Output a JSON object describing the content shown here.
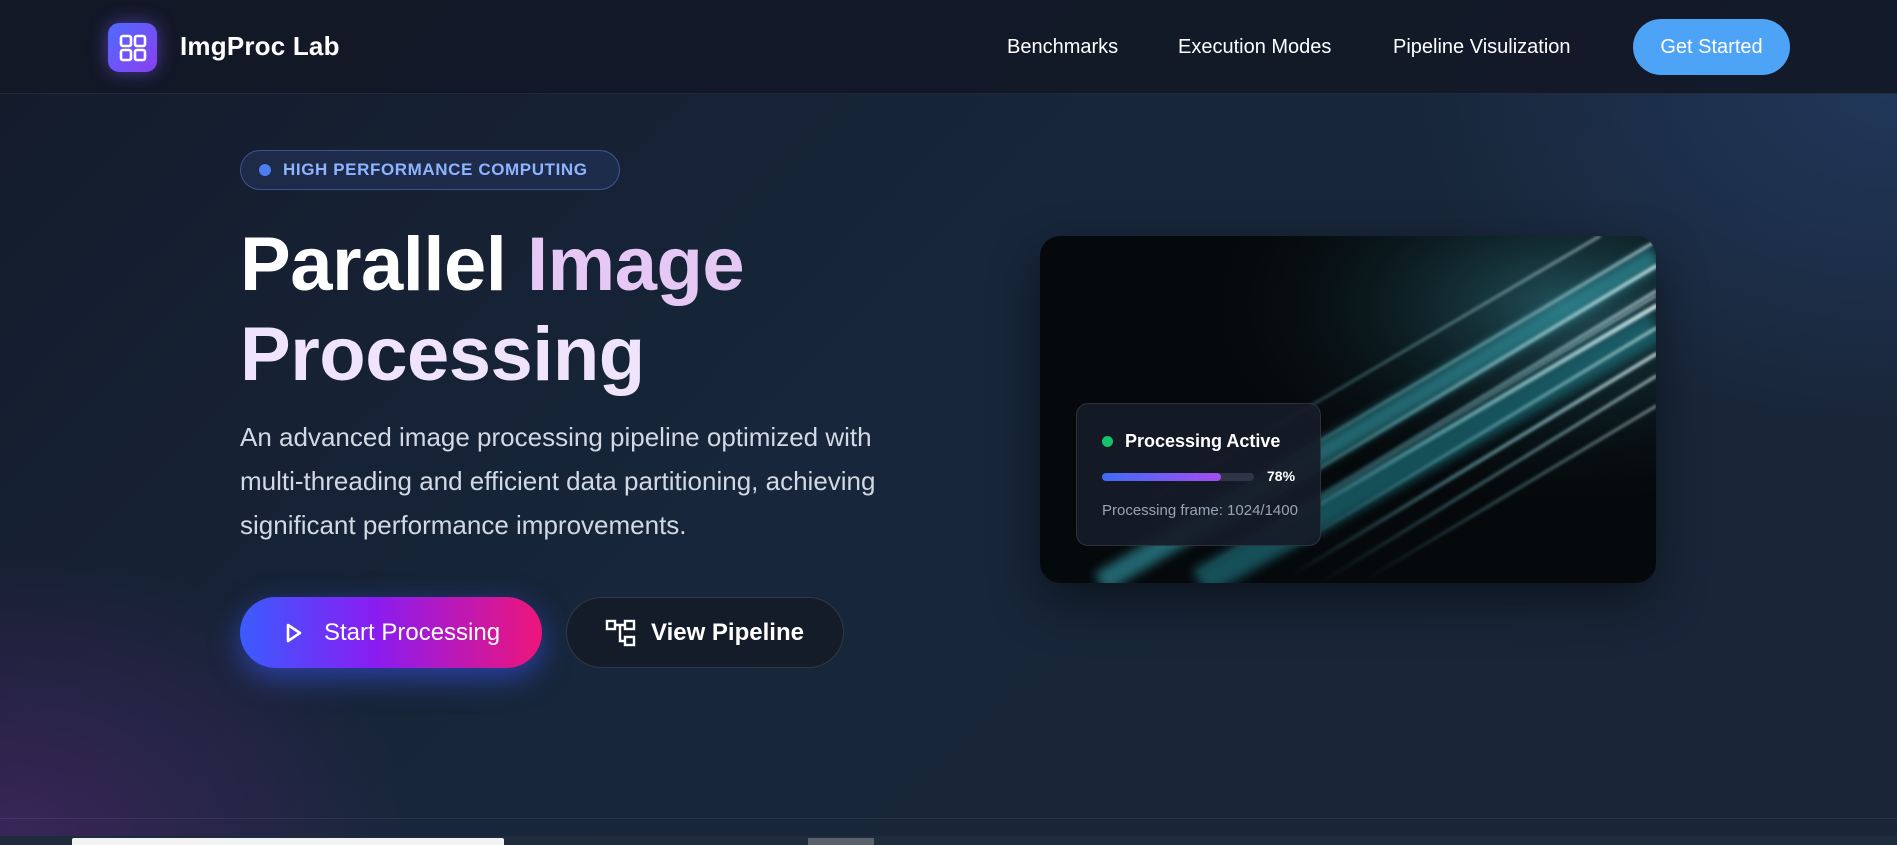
{
  "nav": {
    "brand": "ImgProc Lab",
    "links": [
      "Benchmarks",
      "Execution Modes",
      "Pipeline Visulization"
    ],
    "cta_label": "Get Started"
  },
  "hero": {
    "badge": "HIGH PERFORMANCE COMPUTING",
    "title_line1_a": "Parallel",
    "title_line1_b": "Image",
    "title_line2": "Processing",
    "subtitle": "An advanced image processing pipeline optimized with multi-threading and efficient data partitioning, achieving significant performance improvements.",
    "primary_button": "Start Processing",
    "secondary_button": "View Pipeline"
  },
  "status_card": {
    "title": "Processing Active",
    "progress_percent_label": "78%",
    "progress_fraction": 0.78,
    "frame_label": "Processing frame: 1024/1400"
  },
  "icons": {
    "logo": "grid-icon",
    "primary_button": "play-icon",
    "secondary_button": "pipeline-icon"
  },
  "colors": {
    "accent_blue": "#4da3f5",
    "status_green": "#17c26a",
    "badge_text": "#8fb4ff"
  }
}
